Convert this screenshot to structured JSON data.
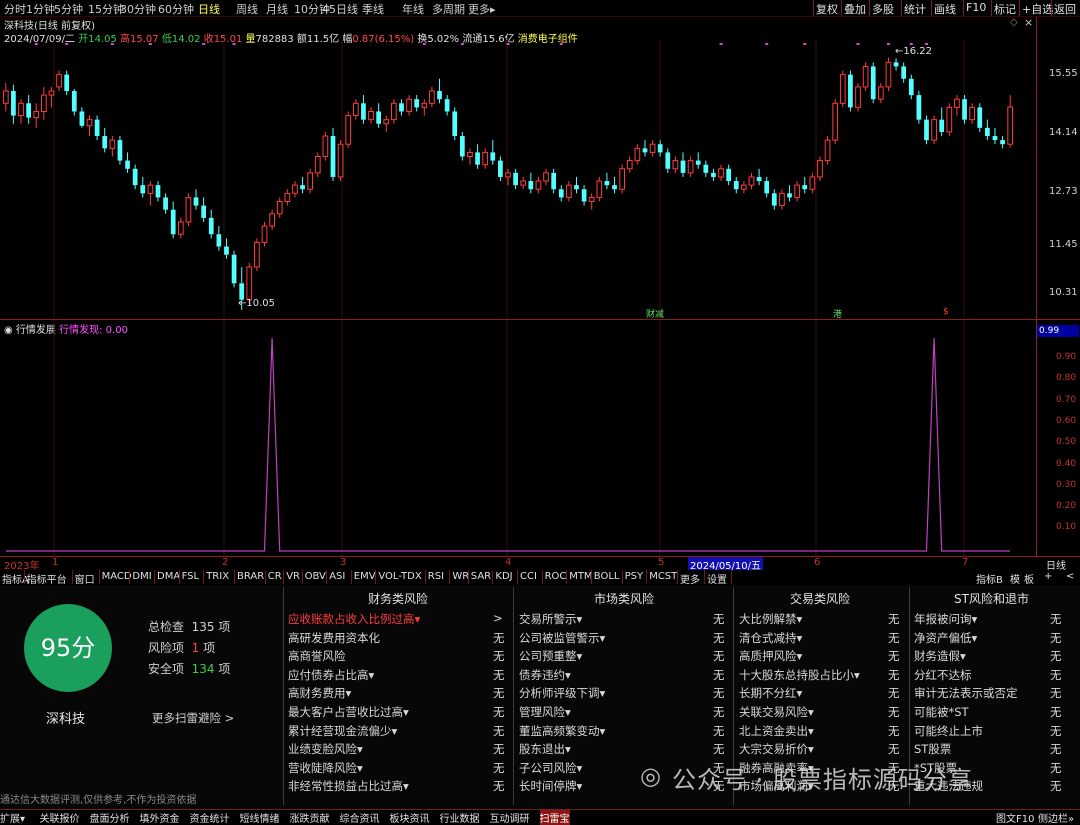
{
  "periods": [
    "分时",
    "1分钟",
    "5分钟",
    "15分钟",
    "30分钟",
    "60分钟",
    "日线",
    "周线",
    "月线",
    "10分钟",
    "45日线",
    "季线",
    "年线",
    "多周期",
    "更多▸"
  ],
  "active_period": "日线",
  "top_right": [
    "复权",
    "叠加",
    "多股",
    "统计",
    "画线",
    "F10",
    "标记",
    "+自选",
    "返回"
  ],
  "stock": {
    "title": "深科技(日线 前复权)",
    "date": "2024/07/09/二",
    "open_label": "开",
    "open": "14.05",
    "high_label": "高",
    "high": "15.07",
    "low_label": "低",
    "low": "14.02",
    "close_label": "收",
    "close": "15.01",
    "vol_label": "量",
    "vol": "782883",
    "amt_label": "额",
    "amt": "11.5亿",
    "chg_label": "幅",
    "chg": "0.87(6.15%)",
    "turn_label": "换",
    "turn": "5.02%",
    "float_label": "流通",
    "float": "15.6亿",
    "sector": "消费电子组件"
  },
  "price_axis": [
    "15.55",
    "14.14",
    "12.73",
    "11.45",
    "10.31"
  ],
  "extreme_high": "16.22",
  "extreme_low": "10.05",
  "chart_markers": [
    "财减",
    "港",
    "$"
  ],
  "indicator": {
    "name": "行情发展",
    "label": "行情发现",
    "value": "0.00",
    "axis_box": "0.99",
    "axis": [
      "0.90",
      "0.80",
      "0.70",
      "0.60",
      "0.50",
      "0.40",
      "0.30",
      "0.20",
      "0.10"
    ]
  },
  "time_axis": {
    "year": "2023年",
    "months": [
      "1",
      "2",
      "3",
      "4",
      "5",
      "6",
      "7"
    ],
    "cursor_date": "2024/05/10/五",
    "right": "日线"
  },
  "tabs": [
    "指标A",
    "指标平台",
    "窗口",
    "MACD",
    "DMI",
    "DMA",
    "FSL",
    "TRIX",
    "BRAR",
    "CR",
    "VR",
    "OBV",
    "ASI",
    "EMV",
    "VOL-TDX",
    "RSI",
    "WR",
    "SAR",
    "KDJ",
    "CCI",
    "ROC",
    "MTM",
    "BOLL",
    "PSY",
    "MCST",
    "更多",
    "设置"
  ],
  "tabs_right": [
    "指标B",
    "模",
    "板",
    "+",
    "<"
  ],
  "summary": {
    "score": "95分",
    "name": "深科技",
    "total_label": "总检查",
    "total": "135",
    "total_unit": "项",
    "risk_label": "风险项",
    "risk": "1",
    "risk_unit": "项",
    "safe_label": "安全项",
    "safe": "134",
    "safe_unit": "项",
    "more_link": "更多扫雷避险 >",
    "disclaimer": "通达信大数据评测,仅供参考,不作为投资依据"
  },
  "columns": [
    {
      "title": "财务类风险",
      "rows": [
        {
          "label": "应收账款占收入比例过高▾",
          "value": ">",
          "risk": true
        },
        {
          "label": "高研发费用资本化",
          "value": "无"
        },
        {
          "label": "高商誉风险",
          "value": "无"
        },
        {
          "label": "应付债券占比高▾",
          "value": "无"
        },
        {
          "label": "高财务费用▾",
          "value": "无"
        },
        {
          "label": "最大客户占营收比过高▾",
          "value": "无"
        },
        {
          "label": "累计经营现金流偏少▾",
          "value": "无"
        },
        {
          "label": "业绩变脸风险▾",
          "value": "无"
        },
        {
          "label": "营收陡降风险▾",
          "value": "无"
        },
        {
          "label": "非经常性损益占比过高▾",
          "value": "无"
        }
      ]
    },
    {
      "title": "市场类风险",
      "rows": [
        {
          "label": "交易所警示▾",
          "value": "无"
        },
        {
          "label": "公司被监管警示▾",
          "value": "无"
        },
        {
          "label": "公司预重整▾",
          "value": "无"
        },
        {
          "label": "债券违约▾",
          "value": "无"
        },
        {
          "label": "分析师评级下调▾",
          "value": "无"
        },
        {
          "label": "管理风险▾",
          "value": "无"
        },
        {
          "label": "董监高频繁变动▾",
          "value": "无"
        },
        {
          "label": "股东退出▾",
          "value": "无"
        },
        {
          "label": "子公司风险▾",
          "value": "无"
        },
        {
          "label": "长时间停牌▾",
          "value": "无"
        }
      ]
    },
    {
      "title": "交易类风险",
      "rows": [
        {
          "label": "大比例解禁▾",
          "value": "无"
        },
        {
          "label": "清仓式减持▾",
          "value": "无"
        },
        {
          "label": "高质押风险▾",
          "value": "无"
        },
        {
          "label": "十大股东总持股占比小▾",
          "value": "无"
        },
        {
          "label": "长期不分红▾",
          "value": "无"
        },
        {
          "label": "关联交易风险▾",
          "value": "无"
        },
        {
          "label": "北上资金卖出▾",
          "value": "无"
        },
        {
          "label": "大宗交易折价▾",
          "value": "无"
        },
        {
          "label": "融券高融卖率▾",
          "value": "无"
        },
        {
          "label": "市场偏离利润▾",
          "value": "无"
        }
      ]
    },
    {
      "title": "ST风险和退市",
      "rows": [
        {
          "label": "年报被问询▾",
          "value": "无"
        },
        {
          "label": "净资产偏低▾",
          "value": "无"
        },
        {
          "label": "财务造假▾",
          "value": "无"
        },
        {
          "label": "分红不达标",
          "value": "无"
        },
        {
          "label": "审计无法表示或否定",
          "value": "无"
        },
        {
          "label": "可能被*ST",
          "value": "无"
        },
        {
          "label": "可能终止上市",
          "value": "无"
        },
        {
          "label": "ST股票",
          "value": "无"
        },
        {
          "label": "*ST股票",
          "value": "无"
        },
        {
          "label": "重大违法违规",
          "value": "无"
        }
      ]
    }
  ],
  "bottom_tabs": [
    "扩展▾",
    "关联报价",
    "盘面分析",
    "填外资金",
    "资金统计",
    "短线情绪",
    "涨跌贡献",
    "综合资讯",
    "板块资讯",
    "行业数据",
    "互动调研",
    "扫雷宝"
  ],
  "bottom_active": "扫雷宝",
  "bottom_right": [
    "图文F10",
    "侧边栏»"
  ],
  "watermark": "公众号 · 股票指标源码分享",
  "colors": {
    "up": "#ff3c3c",
    "down": "#54ffff",
    "frame": "#8a1e1e",
    "indicator_line": "#c040c0",
    "score_bg": "#1aa05c"
  },
  "chart_data": {
    "type": "candlestick",
    "period": "daily",
    "x_range": [
      "2023-12",
      "2024-07-09"
    ],
    "y_range": [
      10.0,
      16.5
    ],
    "candles": [
      [
        15.1,
        15.6,
        14.9,
        15.4
      ],
      [
        15.4,
        15.55,
        14.6,
        14.8
      ],
      [
        14.8,
        15.2,
        14.6,
        15.1
      ],
      [
        15.1,
        15.3,
        14.6,
        14.75
      ],
      [
        14.75,
        15.1,
        14.5,
        14.9
      ],
      [
        14.9,
        15.5,
        14.7,
        15.3
      ],
      [
        15.3,
        15.5,
        15.0,
        15.4
      ],
      [
        15.5,
        15.9,
        15.4,
        15.8
      ],
      [
        15.8,
        15.9,
        15.3,
        15.4
      ],
      [
        15.4,
        15.45,
        14.8,
        14.9
      ],
      [
        14.9,
        15.0,
        14.5,
        14.55
      ],
      [
        14.55,
        14.8,
        14.3,
        14.7
      ],
      [
        14.7,
        14.8,
        14.2,
        14.3
      ],
      [
        14.3,
        14.5,
        13.9,
        14.0
      ],
      [
        14.0,
        14.3,
        13.8,
        14.2
      ],
      [
        14.2,
        14.3,
        13.6,
        13.7
      ],
      [
        13.7,
        13.9,
        13.4,
        13.5
      ],
      [
        13.5,
        13.6,
        13.0,
        13.1
      ],
      [
        13.1,
        13.3,
        12.8,
        12.9
      ],
      [
        12.9,
        13.2,
        12.6,
        13.1
      ],
      [
        13.1,
        13.2,
        12.7,
        12.8
      ],
      [
        12.8,
        12.9,
        12.4,
        12.5
      ],
      [
        12.5,
        12.7,
        11.8,
        11.9
      ],
      [
        11.9,
        12.3,
        11.8,
        12.2
      ],
      [
        12.2,
        12.9,
        12.1,
        12.8
      ],
      [
        12.8,
        13.0,
        12.5,
        12.6
      ],
      [
        12.6,
        12.8,
        12.2,
        12.3
      ],
      [
        12.3,
        12.5,
        11.8,
        11.9
      ],
      [
        11.9,
        12.1,
        11.5,
        11.6
      ],
      [
        11.6,
        11.8,
        11.3,
        11.4
      ],
      [
        11.4,
        11.5,
        10.6,
        10.7
      ],
      [
        10.7,
        11.1,
        10.05,
        10.3
      ],
      [
        10.3,
        11.2,
        10.2,
        11.1
      ],
      [
        11.1,
        11.8,
        11.0,
        11.7
      ],
      [
        11.7,
        12.2,
        11.6,
        12.1
      ],
      [
        12.1,
        12.5,
        12.0,
        12.4
      ],
      [
        12.4,
        12.8,
        12.3,
        12.7
      ],
      [
        12.7,
        13.0,
        12.6,
        12.9
      ],
      [
        12.9,
        13.2,
        12.8,
        13.1
      ],
      [
        13.1,
        13.3,
        12.9,
        13.0
      ],
      [
        13.0,
        13.5,
        12.9,
        13.4
      ],
      [
        13.4,
        13.9,
        13.3,
        13.8
      ],
      [
        13.8,
        14.4,
        13.7,
        14.3
      ],
      [
        14.3,
        14.5,
        13.2,
        13.3
      ],
      [
        13.3,
        14.2,
        13.2,
        14.1
      ],
      [
        14.1,
        14.9,
        14.0,
        14.8
      ],
      [
        14.8,
        15.2,
        14.7,
        15.1
      ],
      [
        15.1,
        15.3,
        14.6,
        14.7
      ],
      [
        14.7,
        15.0,
        14.6,
        14.9
      ],
      [
        14.9,
        15.1,
        14.5,
        14.6
      ],
      [
        14.6,
        14.8,
        14.4,
        14.7
      ],
      [
        14.7,
        15.2,
        14.6,
        15.1
      ],
      [
        15.1,
        15.2,
        14.8,
        14.9
      ],
      [
        14.9,
        15.3,
        14.8,
        15.2
      ],
      [
        15.2,
        15.3,
        14.9,
        15.0
      ],
      [
        15.0,
        15.2,
        14.8,
        15.1
      ],
      [
        15.1,
        15.5,
        15.0,
        15.4
      ],
      [
        15.4,
        15.7,
        15.1,
        15.2
      ],
      [
        15.2,
        15.3,
        14.8,
        14.9
      ],
      [
        14.9,
        15.0,
        14.2,
        14.3
      ],
      [
        14.3,
        14.4,
        13.7,
        13.8
      ],
      [
        13.8,
        14.0,
        13.6,
        13.9
      ],
      [
        13.9,
        14.1,
        13.5,
        13.6
      ],
      [
        13.6,
        14.0,
        13.5,
        13.9
      ],
      [
        13.9,
        14.2,
        13.6,
        13.7
      ],
      [
        13.7,
        13.8,
        13.2,
        13.3
      ],
      [
        13.3,
        13.5,
        13.1,
        13.4
      ],
      [
        13.4,
        13.5,
        13.0,
        13.1
      ],
      [
        13.1,
        13.3,
        13.0,
        13.2
      ],
      [
        13.2,
        13.4,
        12.9,
        13.0
      ],
      [
        13.0,
        13.3,
        12.9,
        13.2
      ],
      [
        13.2,
        13.5,
        13.1,
        13.4
      ],
      [
        13.4,
        13.5,
        12.9,
        13.0
      ],
      [
        13.0,
        13.1,
        12.7,
        12.8
      ],
      [
        12.8,
        13.2,
        12.7,
        13.1
      ],
      [
        13.1,
        13.3,
        12.9,
        13.0
      ],
      [
        13.0,
        13.1,
        12.6,
        12.7
      ],
      [
        12.7,
        12.9,
        12.5,
        12.8
      ],
      [
        12.8,
        13.3,
        12.7,
        13.2
      ],
      [
        13.2,
        13.4,
        13.0,
        13.1
      ],
      [
        13.1,
        13.3,
        12.9,
        13.0
      ],
      [
        13.0,
        13.6,
        12.9,
        13.5
      ],
      [
        13.5,
        13.8,
        13.4,
        13.7
      ],
      [
        13.7,
        14.1,
        13.6,
        14.0
      ],
      [
        14.0,
        14.2,
        13.8,
        13.9
      ],
      [
        13.9,
        14.2,
        13.8,
        14.1
      ],
      [
        14.1,
        14.2,
        13.8,
        13.9
      ],
      [
        13.9,
        14.0,
        13.4,
        13.5
      ],
      [
        13.5,
        13.8,
        13.4,
        13.7
      ],
      [
        13.7,
        13.9,
        13.3,
        13.4
      ],
      [
        13.4,
        13.8,
        13.3,
        13.7
      ],
      [
        13.7,
        13.9,
        13.5,
        13.6
      ],
      [
        13.6,
        13.7,
        13.3,
        13.4
      ],
      [
        13.4,
        13.5,
        13.2,
        13.3
      ],
      [
        13.3,
        13.6,
        13.2,
        13.5
      ],
      [
        13.5,
        13.6,
        13.1,
        13.2
      ],
      [
        13.2,
        13.3,
        12.9,
        13.0
      ],
      [
        13.0,
        13.2,
        12.9,
        13.1
      ],
      [
        13.1,
        13.4,
        13.0,
        13.3
      ],
      [
        13.3,
        13.5,
        13.1,
        13.2
      ],
      [
        13.2,
        13.3,
        12.8,
        12.9
      ],
      [
        12.9,
        13.0,
        12.5,
        12.6
      ],
      [
        12.6,
        13.0,
        12.5,
        12.9
      ],
      [
        12.9,
        13.1,
        12.7,
        12.8
      ],
      [
        12.8,
        13.2,
        12.7,
        13.1
      ],
      [
        13.1,
        13.3,
        12.9,
        13.0
      ],
      [
        13.0,
        13.4,
        12.9,
        13.3
      ],
      [
        13.3,
        13.8,
        13.2,
        13.7
      ],
      [
        13.7,
        14.3,
        13.6,
        14.2
      ],
      [
        14.2,
        15.2,
        14.1,
        15.1
      ],
      [
        15.1,
        15.9,
        15.0,
        15.8
      ],
      [
        15.8,
        15.9,
        14.9,
        15.0
      ],
      [
        15.0,
        15.6,
        14.9,
        15.5
      ],
      [
        15.5,
        16.1,
        15.4,
        16.0
      ],
      [
        16.0,
        16.1,
        15.1,
        15.2
      ],
      [
        15.2,
        15.6,
        15.1,
        15.5
      ],
      [
        15.5,
        16.22,
        15.4,
        16.1
      ],
      [
        16.1,
        16.2,
        15.9,
        16.0
      ],
      [
        16.0,
        16.1,
        15.6,
        15.7
      ],
      [
        15.7,
        15.8,
        15.2,
        15.3
      ],
      [
        15.3,
        15.4,
        14.6,
        14.7
      ],
      [
        14.7,
        14.8,
        14.1,
        14.2
      ],
      [
        14.2,
        14.8,
        14.1,
        14.7
      ],
      [
        14.7,
        15.0,
        14.3,
        14.4
      ],
      [
        14.4,
        15.1,
        14.3,
        15.0
      ],
      [
        15.0,
        15.3,
        14.8,
        15.2
      ],
      [
        15.2,
        15.3,
        14.6,
        14.7
      ],
      [
        14.7,
        15.1,
        14.6,
        15.0
      ],
      [
        15.0,
        15.1,
        14.4,
        14.5
      ],
      [
        14.5,
        14.7,
        14.2,
        14.3
      ],
      [
        14.3,
        14.5,
        14.1,
        14.2
      ],
      [
        14.2,
        14.3,
        14.0,
        14.1
      ],
      [
        14.1,
        15.3,
        14.02,
        15.01
      ]
    ],
    "indicator_series": {
      "name": "行情发现",
      "y_range": [
        0,
        1
      ],
      "spikes_at_index": [
        35,
        122
      ],
      "spike_value": 0.99
    }
  }
}
